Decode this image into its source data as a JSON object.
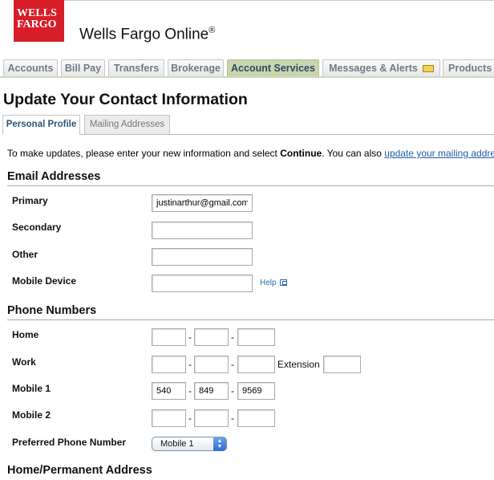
{
  "header": {
    "logo_line1": "WELLS",
    "logo_line2": "FARGO",
    "brand_name": "Wells Fargo Online",
    "brand_reg": "®"
  },
  "nav": {
    "tabs": [
      {
        "label": "Accounts"
      },
      {
        "label": "Bill Pay"
      },
      {
        "label": "Transfers"
      },
      {
        "label": "Brokerage"
      },
      {
        "label": "Account Services"
      },
      {
        "label": "Messages & Alerts"
      },
      {
        "label": "Products &"
      }
    ],
    "active": "Account Services"
  },
  "page": {
    "title": "Update Your Contact Information",
    "subtabs": [
      {
        "label": "Personal Profile"
      },
      {
        "label": "Mailing Addresses"
      }
    ],
    "intro_prefix": "To make updates, please enter your new information and select ",
    "intro_bold": "Continue",
    "intro_mid": ". You can also ",
    "intro_link": "update your mailing addre"
  },
  "email": {
    "heading": "Email Addresses",
    "primary_label": "Primary",
    "primary_value": "justinarthur@gmail.com",
    "secondary_label": "Secondary",
    "secondary_value": "",
    "other_label": "Other",
    "other_value": "",
    "mobile_label": "Mobile Device",
    "mobile_value": "",
    "help_label": "Help"
  },
  "phone": {
    "heading": "Phone Numbers",
    "dash": "-",
    "home_label": "Home",
    "home": [
      "",
      "",
      ""
    ],
    "work_label": "Work",
    "work": [
      "",
      "",
      ""
    ],
    "extension_label": "Extension",
    "extension_value": "",
    "mobile1_label": "Mobile 1",
    "mobile1": [
      "540",
      "849",
      "9569"
    ],
    "mobile2_label": "Mobile 2",
    "mobile2": [
      "",
      "",
      ""
    ],
    "preferred_label": "Preferred Phone Number",
    "preferred_value": "Mobile 1"
  },
  "address": {
    "heading": "Home/Permanent Address"
  },
  "colors": {
    "brand_red": "#d71e28",
    "active_tab": "#c9d5ad",
    "link": "#1f5fa0"
  },
  "icons": [
    "envelope-icon",
    "popup-window-icon",
    "select-arrows-icon"
  ]
}
